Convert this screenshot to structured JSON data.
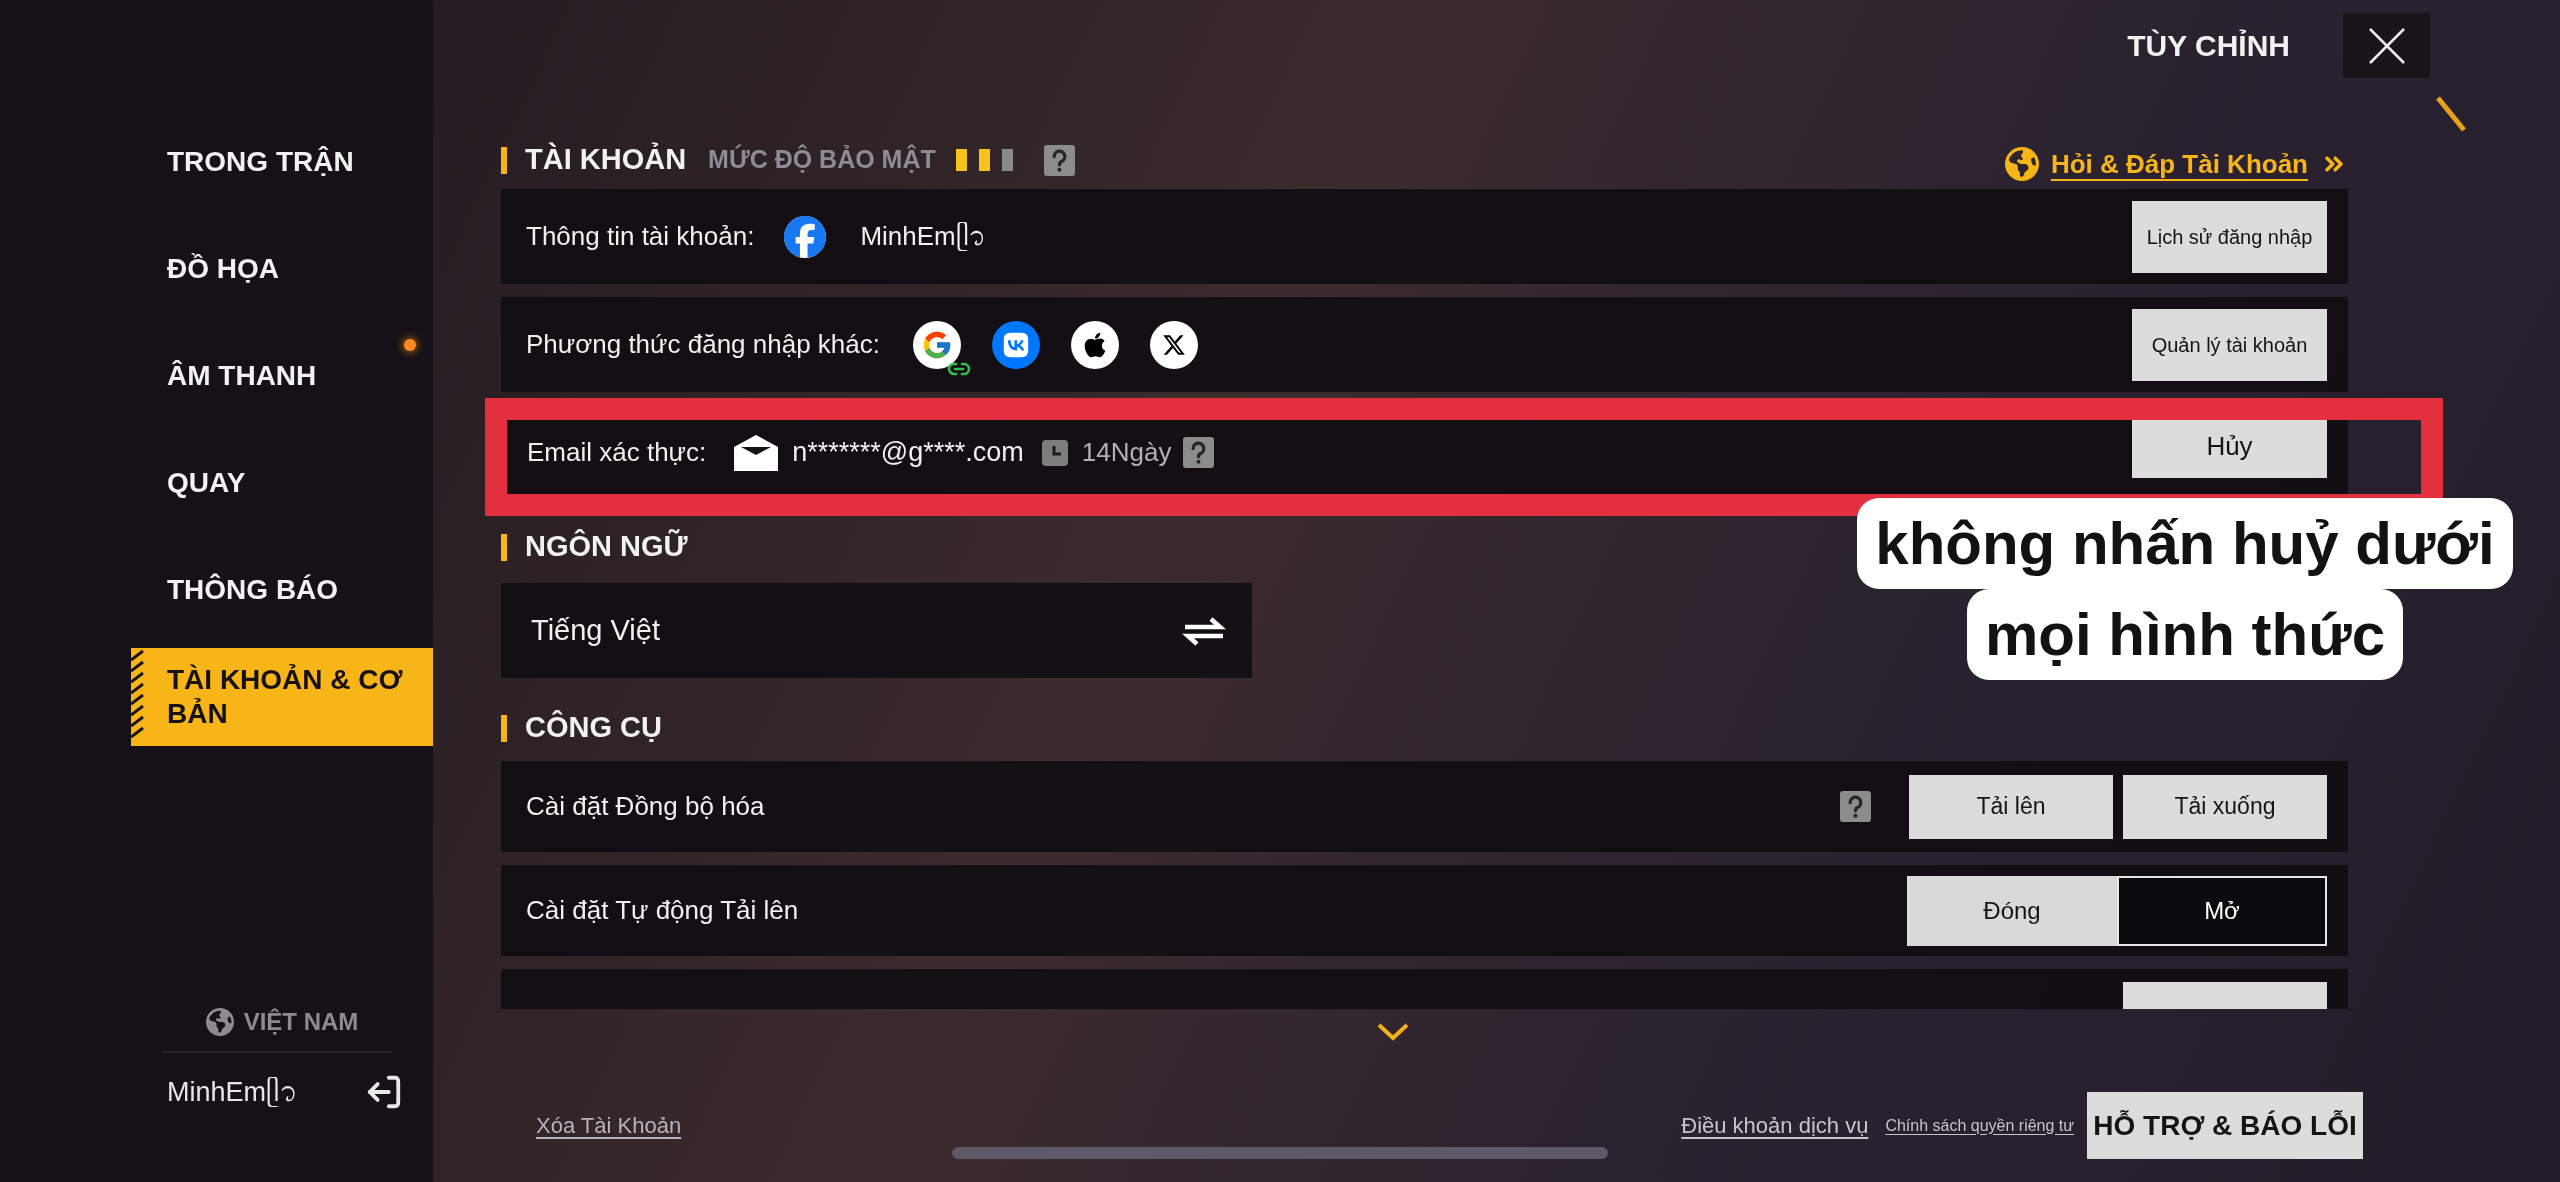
{
  "header": {
    "title": "TÙY CHỈNH"
  },
  "sidebar": {
    "items": [
      {
        "label": "TRONG TRẬN",
        "selected": false
      },
      {
        "label": "ĐỒ HỌA",
        "selected": false
      },
      {
        "label": "ÂM THANH",
        "selected": false
      },
      {
        "label": "QUAY",
        "selected": false
      },
      {
        "label": "THÔNG BÁO",
        "selected": false
      },
      {
        "label": "TÀI KHOẢN & CƠ BẢN",
        "selected": true
      }
    ],
    "region": "VIỆT NAM",
    "username": "MinhEmᥫ᭡"
  },
  "account_section": {
    "title": "TÀI KHOẢN",
    "security": {
      "label": "MỨC ĐỘ BẢO MẬT",
      "level": 0.67
    },
    "help_link": "Hỏi & Đáp Tài Khoản",
    "account_info": {
      "label": "Thông tin tài khoản:",
      "provider": {
        "kind": "facebook"
      },
      "name": "MinhEmᥫ᭡",
      "button": "Lịch sử đăng nhập"
    },
    "login_methods": {
      "label": "Phương thức đăng nhập khác:",
      "methods": [
        {
          "kind": "google",
          "linked": true
        },
        {
          "kind": "vk",
          "linked": false
        },
        {
          "kind": "apple",
          "linked": false
        },
        {
          "kind": "x",
          "linked": false
        }
      ],
      "button": "Quản lý tài khoản"
    },
    "email": {
      "label": "Email xác thực:",
      "address": "n*******@g****.com",
      "validity": "14Ngày",
      "button": "Hủy"
    }
  },
  "annotation": {
    "note": "không nhấn huỷ dưới mọi hình thức"
  },
  "language_section": {
    "title": "NGÔN NGỮ",
    "value": "Tiếng Việt"
  },
  "tools_section": {
    "title": "CÔNG CỤ",
    "rows": [
      {
        "kind": "buttons",
        "label": "Cài đặt Đồng bộ hóa",
        "help": true,
        "buttons": [
          "Tải lên",
          "Tải xuống"
        ]
      },
      {
        "kind": "toggle",
        "label": "Cài đặt Tự động Tải lên",
        "options": [
          {
            "label": "Đóng",
            "selected": false
          },
          {
            "label": "Mở",
            "selected": true
          }
        ]
      },
      {
        "kind": "cut_off"
      }
    ]
  },
  "footer": {
    "delete_link": "Xóa Tài Khoản",
    "links": [
      "Điều khoản dịch vụ",
      "Chính sách quyền riêng tư"
    ],
    "support_button": "HỖ TRỢ & BÁO LỖI"
  }
}
